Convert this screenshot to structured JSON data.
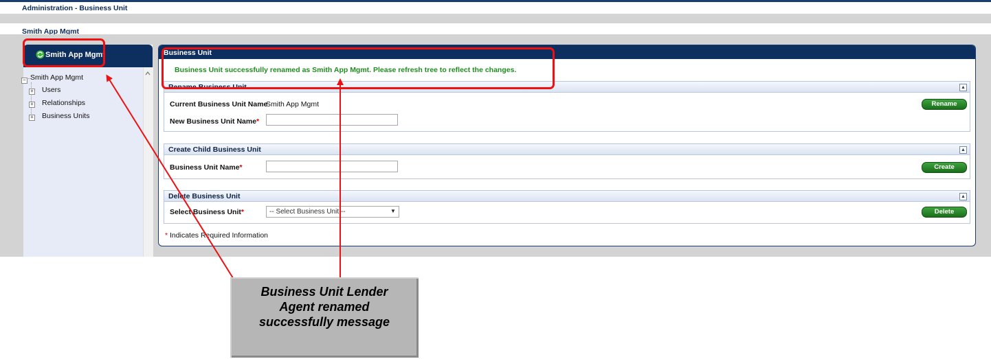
{
  "page": {
    "title": "Administration - Business Unit",
    "subtitle": "Smith App Mgmt"
  },
  "sidebar": {
    "header": "Smith App Mgmt",
    "tree_root": "Smith App Mgmt",
    "tree_items": [
      "Users",
      "Relationships",
      "Business Units"
    ]
  },
  "main": {
    "header": "Business Unit",
    "success_message": "Business Unit successfully renamed as Smith App Mgmt. Please refresh tree to reflect the changes.",
    "rename": {
      "title": "Rename Business Unit",
      "current_label": "Current Business Unit Name",
      "current_value": "Smith App Mgmt",
      "new_label": "New Business Unit Name",
      "new_value": "",
      "button": "Rename"
    },
    "create": {
      "title": "Create Child Business Unit",
      "name_label": "Business Unit Name",
      "name_value": "",
      "button": "Create"
    },
    "delete": {
      "title": "Delete Business Unit",
      "select_label": "Select Business Unit",
      "select_value": "-- Select Business Unit --",
      "button": "Delete"
    },
    "required_asterisk": "*",
    "required_note": "Indicates Required Information"
  },
  "callout": {
    "lines": [
      "Business Unit Lender",
      "Agent renamed",
      "successfully message"
    ]
  },
  "colors": {
    "header_navy": "#0d2f5f",
    "success_green": "#1f8d1f",
    "highlight_red": "#ee1111",
    "button_green": "#2a8a2a"
  },
  "icons": {
    "sidebar_header": "sync-icon",
    "tree_expand": "plus-box-icon",
    "tree_collapse": "minus-box-icon",
    "section_collapse": "caret-up-icon"
  }
}
